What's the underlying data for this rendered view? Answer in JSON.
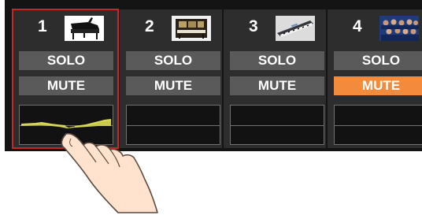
{
  "tracks": [
    {
      "number": "1",
      "solo_label": "SOLO",
      "mute_label": "MUTE",
      "selected": true,
      "mute_on": false,
      "thumbnail": "grand-piano-icon"
    },
    {
      "number": "2",
      "solo_label": "SOLO",
      "mute_label": "MUTE",
      "selected": false,
      "mute_on": false,
      "thumbnail": "acoustic-piano-icon"
    },
    {
      "number": "3",
      "solo_label": "SOLO",
      "mute_label": "MUTE",
      "selected": false,
      "mute_on": false,
      "thumbnail": "keyboard-icon"
    },
    {
      "number": "4",
      "solo_label": "SOLO",
      "mute_label": "MUTE",
      "selected": false,
      "mute_on": true,
      "thumbnail": "choir-icon"
    }
  ],
  "colors": {
    "selected_outline": "#c62828",
    "mute_active": "#f28c3c",
    "button": "#5a5a5a",
    "meter_wave": "#c9c94a"
  }
}
